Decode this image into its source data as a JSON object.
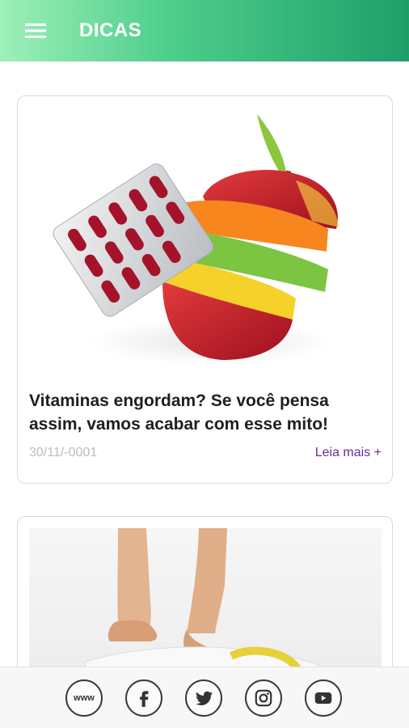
{
  "appbar": {
    "title": "DICAS",
    "menu_icon": "hamburger-icon"
  },
  "cards": [
    {
      "title": "Vitaminas engordam? Se você pensa assim, vamos acabar com esse mito!",
      "date": "30/11/-0001",
      "read_more": "Leia mais +",
      "image": "vitamin-pills-and-sliced-apple-image"
    },
    {
      "image": "feet-stepping-on-scale-image"
    }
  ],
  "footer": {
    "links": [
      {
        "icon": "www-icon",
        "label": "www"
      },
      {
        "icon": "facebook-icon"
      },
      {
        "icon": "twitter-icon"
      },
      {
        "icon": "instagram-icon"
      },
      {
        "icon": "youtube-icon"
      }
    ]
  },
  "colors": {
    "appbar_start": "#9ef0b8",
    "appbar_end": "#1f9e6a",
    "read_more": "#6a2b95",
    "date": "#bdbdbd"
  }
}
